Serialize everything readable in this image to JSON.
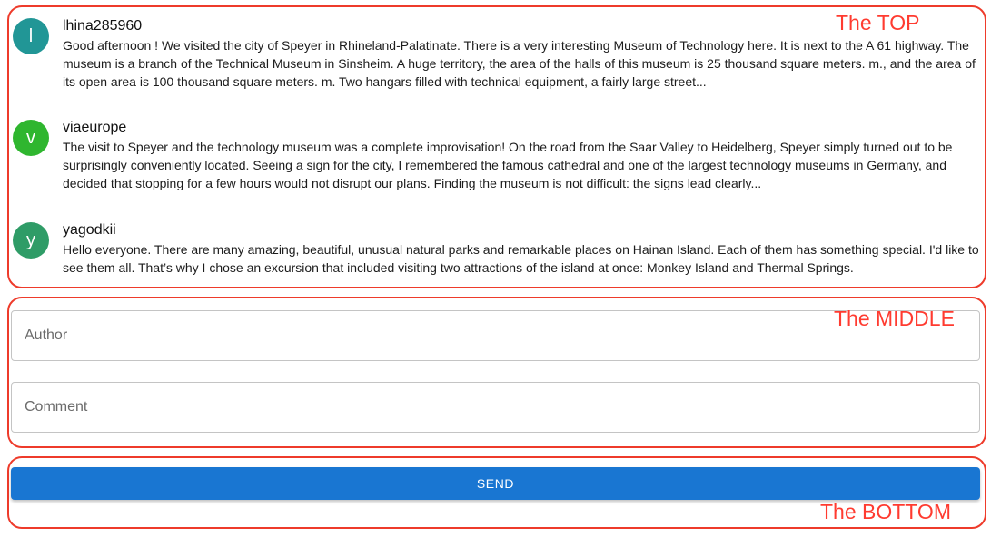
{
  "annotations": {
    "top_label": "The TOP",
    "middle_label": "The MIDDLE",
    "bottom_label": "The BOTTOM",
    "color": "#ff3b30"
  },
  "comments": [
    {
      "avatar_letter": "l",
      "avatar_color": "#219696",
      "author": "lhina285960",
      "text": "Good afternoon ! We visited the city of Speyer in Rhineland-Palatinate. There is a very interesting Museum of Technology here. It is next to the A 61 highway. The museum is a branch of the Technical Museum in Sinsheim. A huge territory, the area of the halls of this museum is 25 thousand square meters. m., and the area of its open area is 100 thousand square meters. m. Two hangars filled with technical equipment, a fairly large street..."
    },
    {
      "avatar_letter": "v",
      "avatar_color": "#2fb62f",
      "author": "viaeurope",
      "text": "The visit to Speyer and the technology museum was a complete improvisation! On the road from the Saar Valley to Heidelberg, Speyer simply turned out to be surprisingly conveniently located. Seeing a sign for the city, I remembered the famous cathedral and one of the largest technology museums in Germany, and decided that stopping for a few hours would not disrupt our plans. Finding the museum is not difficult: the signs lead clearly..."
    },
    {
      "avatar_letter": "y",
      "avatar_color": "#2f9c67",
      "author": "yagodkii",
      "text": "Hello everyone. There are many amazing, beautiful, unusual natural parks and remarkable places on Hainan Island. Each of them has something special. I'd like to see them all. That’s why I chose an excursion that included visiting two attractions of the island at once: Monkey Island and Thermal Springs."
    }
  ],
  "form": {
    "author_placeholder": "Author",
    "author_value": "",
    "comment_placeholder": "Comment",
    "comment_value": "",
    "send_label": "SEND",
    "send_color": "#1976d2"
  }
}
